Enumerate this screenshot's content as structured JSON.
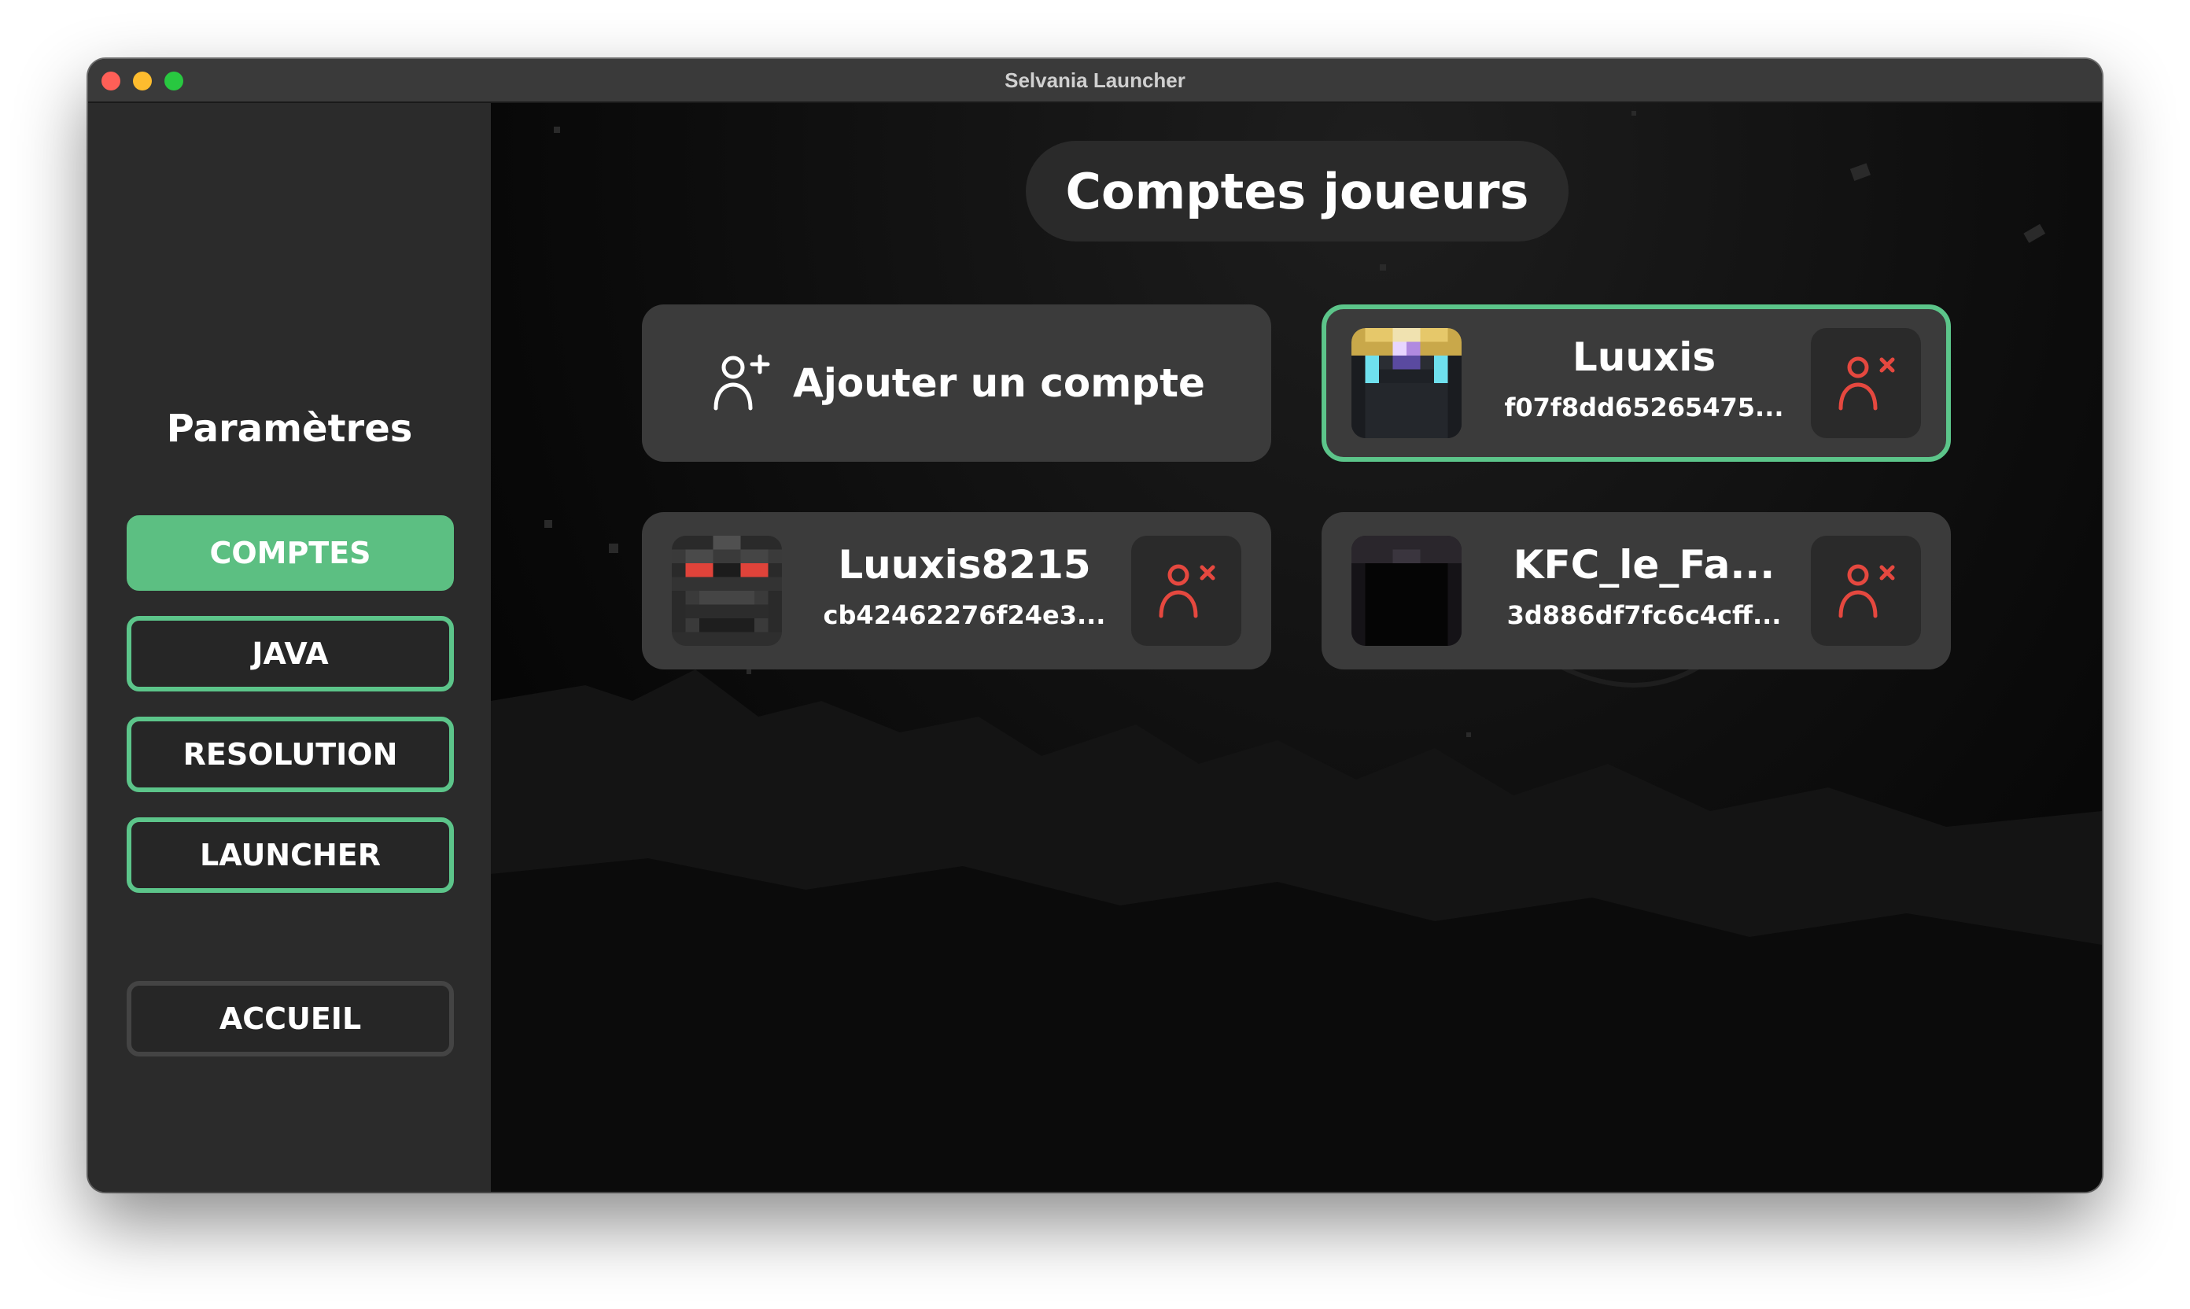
{
  "window": {
    "title": "Selvania Launcher"
  },
  "sidebar": {
    "title": "Paramètres",
    "items": [
      {
        "label": "COMPTES",
        "active": true
      },
      {
        "label": "JAVA",
        "active": false
      },
      {
        "label": "RESOLUTION",
        "active": false
      },
      {
        "label": "LAUNCHER",
        "active": false
      }
    ],
    "home_label": "ACCUEIL"
  },
  "main": {
    "title": "Comptes joueurs",
    "add_account_label": "Ajouter un compte",
    "accounts": [
      {
        "name": "Luuxis",
        "uuid": "f07f8dd65265475...",
        "selected": true,
        "avatar": "gold-crowned-skin"
      },
      {
        "name": "Luuxis8215",
        "uuid": "cb42462276f24e3...",
        "selected": false,
        "avatar": "dark-red-eyed-skin"
      },
      {
        "name": "KFC_le_Fa...",
        "uuid": "3d886df7fc6c4cff...",
        "selected": false,
        "avatar": "black-hooded-skin"
      }
    ]
  },
  "icons": {
    "add_user": "user-plus-icon",
    "remove_user": "user-remove-icon"
  },
  "colors": {
    "accent": "#5cbf82",
    "danger": "#e5483f",
    "sidebar": "#2b2b2b",
    "card": "#3b3b3b"
  }
}
